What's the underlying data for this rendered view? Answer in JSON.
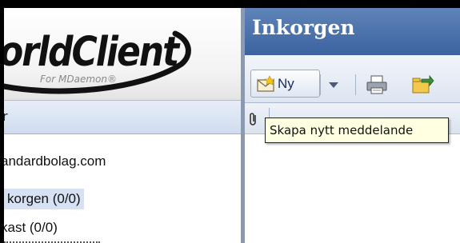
{
  "app": {
    "logo_text": "orldClient",
    "logo_subtitle": "For MDaemon®"
  },
  "sidebar": {
    "header_label": "r",
    "account_label": "andardbolag.com",
    "folders": [
      {
        "label": "korgen (0/0)",
        "selected": true
      },
      {
        "label": "kast (0/0)",
        "selected": false
      }
    ]
  },
  "main": {
    "title": "Inkorgen",
    "toolbar": {
      "new_label": "Ny",
      "new_icon": "new-message-icon",
      "dropdown_icon": "chevron-down-icon",
      "print_icon": "print-icon",
      "move_icon": "move-folder-icon"
    },
    "columns": {
      "attachment_icon": "paperclip-icon"
    },
    "tooltip": "Skapa nytt meddelande"
  },
  "colors": {
    "title_bar": "#4a6fab",
    "selection": "#d6e1f3",
    "tooltip_bg": "#ffffe1"
  }
}
